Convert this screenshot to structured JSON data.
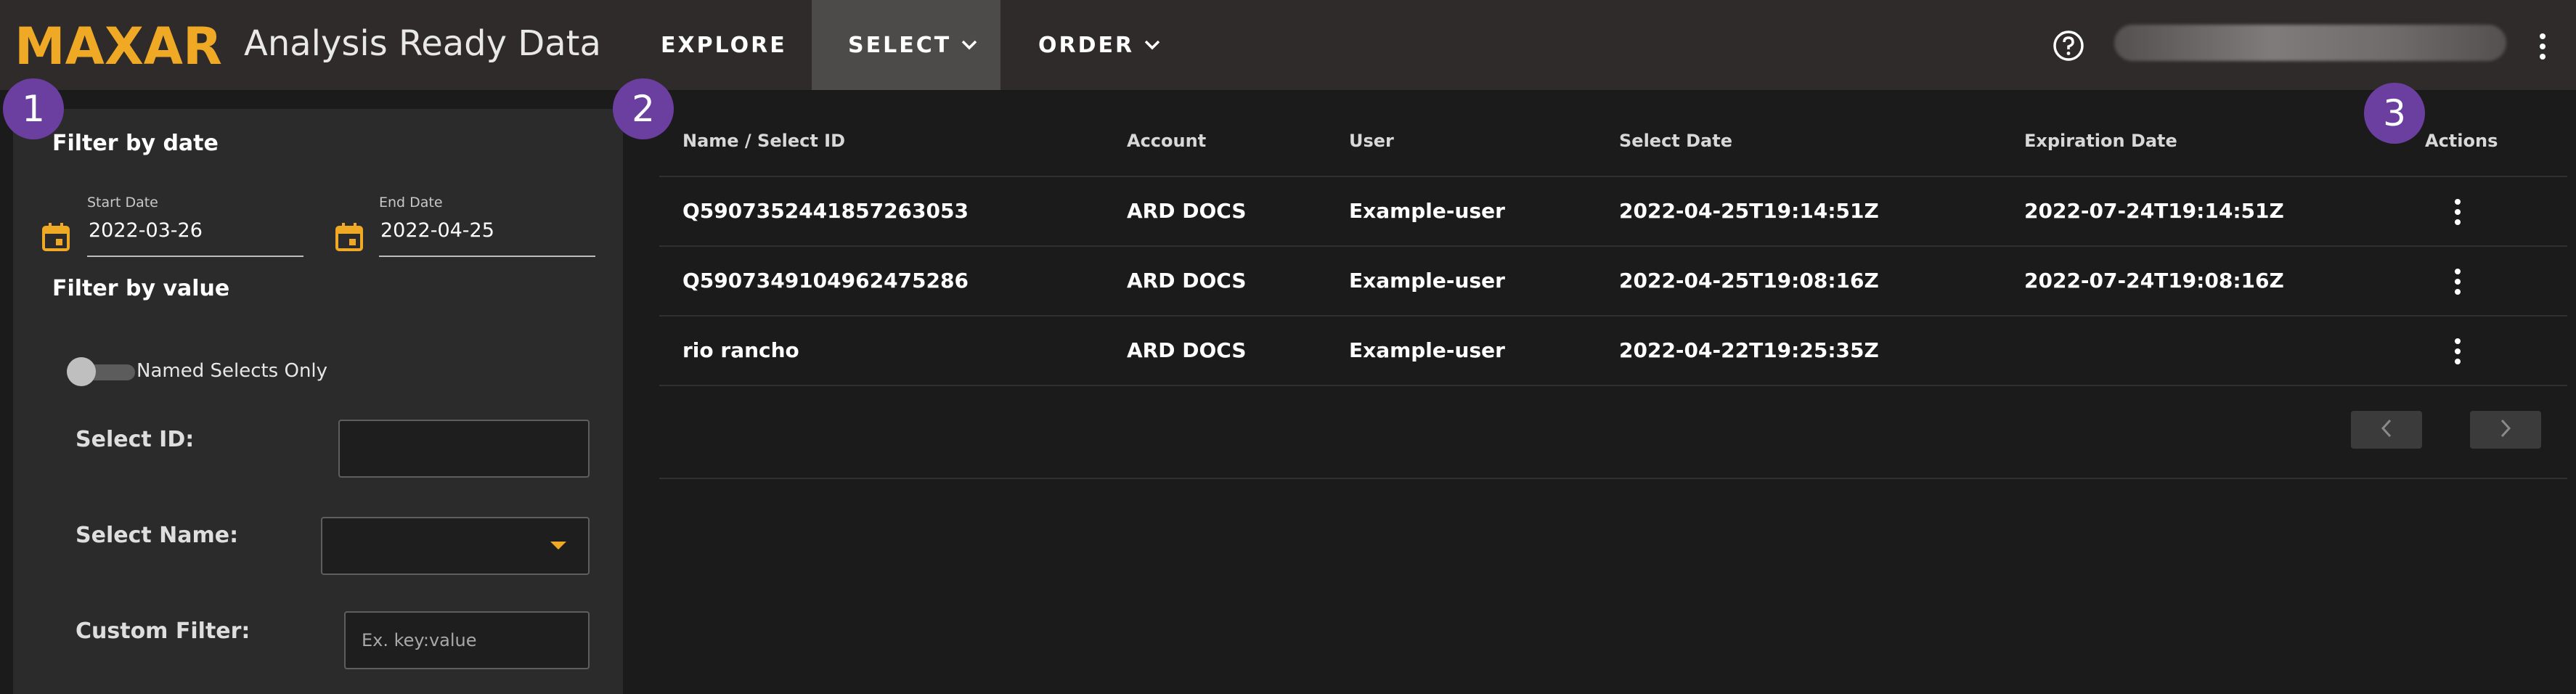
{
  "header": {
    "logo_text": "MAXAR",
    "app_title": "Analysis Ready Data",
    "nav": {
      "explore": "EXPLORE",
      "select": "SELECT",
      "order": "ORDER"
    },
    "icons": {
      "help": "help-circle-icon",
      "more": "more-vertical-icon"
    }
  },
  "badges": {
    "one": "1",
    "two": "2",
    "three": "3"
  },
  "filters": {
    "date_heading": "Filter by date",
    "start_label": "Start Date",
    "start_value": "2022-03-26",
    "end_label": "End Date",
    "end_value": "2022-04-25",
    "value_heading": "Filter by value",
    "named_toggle_label": "Named Selects Only",
    "named_toggle_on": false,
    "select_id_label": "Select ID:",
    "select_id_value": "",
    "select_name_label": "Select Name:",
    "select_name_value": "",
    "custom_filter_label": "Custom Filter:",
    "custom_filter_placeholder": "Ex. key:value"
  },
  "table": {
    "columns": {
      "name": "Name / Select ID",
      "account": "Account",
      "user": "User",
      "select_date": "Select Date",
      "expiration_date": "Expiration Date",
      "actions": "Actions"
    },
    "rows": [
      {
        "name": "Q5907352441857263053",
        "account": "ARD DOCS",
        "user": "Example-user",
        "select_date": "2022-04-25T19:14:51Z",
        "expiration_date": "2022-07-24T19:14:51Z"
      },
      {
        "name": "Q5907349104962475286",
        "account": "ARD DOCS",
        "user": "Example-user",
        "select_date": "2022-04-25T19:08:16Z",
        "expiration_date": "2022-07-24T19:08:16Z"
      },
      {
        "name": "rio rancho",
        "account": "ARD DOCS",
        "user": "Example-user",
        "select_date": "2022-04-22T19:25:35Z",
        "expiration_date": ""
      }
    ]
  },
  "colors": {
    "accent": "#f0a925",
    "badge": "#6b3fa0",
    "topbar": "#2e2b2a",
    "panel": "#2b2b2b",
    "background": "#1b1b1b"
  }
}
